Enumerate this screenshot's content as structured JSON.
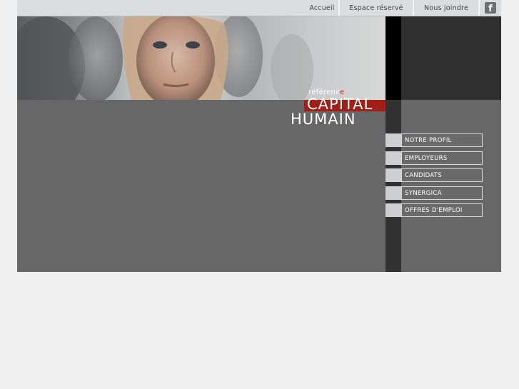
{
  "topnav": {
    "accueil": "Accueil",
    "espace": "Espace réservé",
    "joindre": "Nous joindre",
    "facebook_icon": "facebook-icon"
  },
  "logo": {
    "reference_prefix": "référenc",
    "reference_suffix": "e",
    "capital": "CAPITAL",
    "humain": "HUMAIN"
  },
  "menu": {
    "items": [
      {
        "label": "NOTRE PROFIL"
      },
      {
        "label": "EMPLOYEURS"
      },
      {
        "label": "CANDIDATS"
      },
      {
        "label": "SYNERGICA"
      },
      {
        "label": "OFFRES D'EMPLOI"
      }
    ]
  },
  "colors": {
    "accent": "#a11f16",
    "panel": "#676767",
    "background": "#efefef"
  }
}
